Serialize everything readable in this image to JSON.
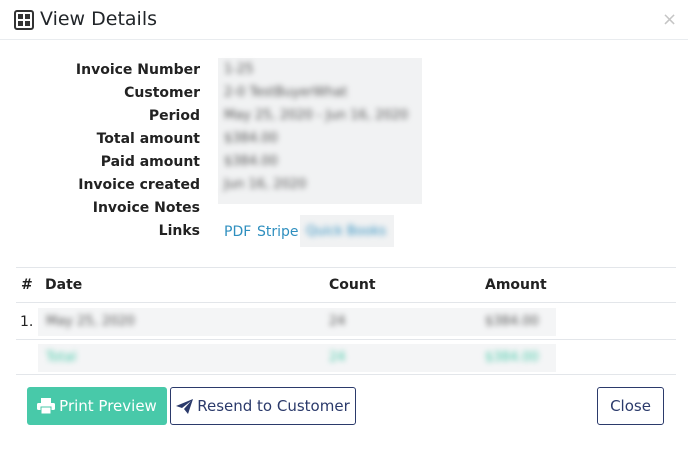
{
  "modal": {
    "title": "View Details",
    "title_icon": "grid-window-icon",
    "close_symbol": "×"
  },
  "details": {
    "invoice_number": {
      "label": "Invoice Number",
      "value": "1-25"
    },
    "customer": {
      "label": "Customer",
      "value": "2-0 TestBuyerWhat"
    },
    "period": {
      "label": "Period",
      "value": "May 25, 2020 - Jun 16, 2020"
    },
    "total_amount": {
      "label": "Total amount",
      "value": "$384.00"
    },
    "paid_amount": {
      "label": "Paid amount",
      "value": "$384.00"
    },
    "invoice_created": {
      "label": "Invoice created",
      "value": "Jun 16, 2020"
    },
    "invoice_notes": {
      "label": "Invoice Notes",
      "value": ""
    },
    "links": {
      "label": "Links",
      "pdf": "PDF",
      "stripe": "Stripe",
      "extra": "Quick Books"
    }
  },
  "table": {
    "headers": {
      "num": "#",
      "date": "Date",
      "count": "Count",
      "amount": "Amount"
    },
    "rows": [
      {
        "num": "1.",
        "date": "May 25, 2020",
        "count": "24",
        "amount": "$384.00"
      }
    ],
    "total": {
      "label": "Total",
      "count": "24",
      "amount": "$384.00"
    }
  },
  "footer": {
    "print_label": "Print Preview",
    "resend_label": "Resend to Customer",
    "close_label": "Close"
  },
  "colors": {
    "print_button": "#48c9a9",
    "outline_button": "#2b3a6b",
    "link": "#2f8fbf",
    "total_row": "#48c9a9"
  }
}
